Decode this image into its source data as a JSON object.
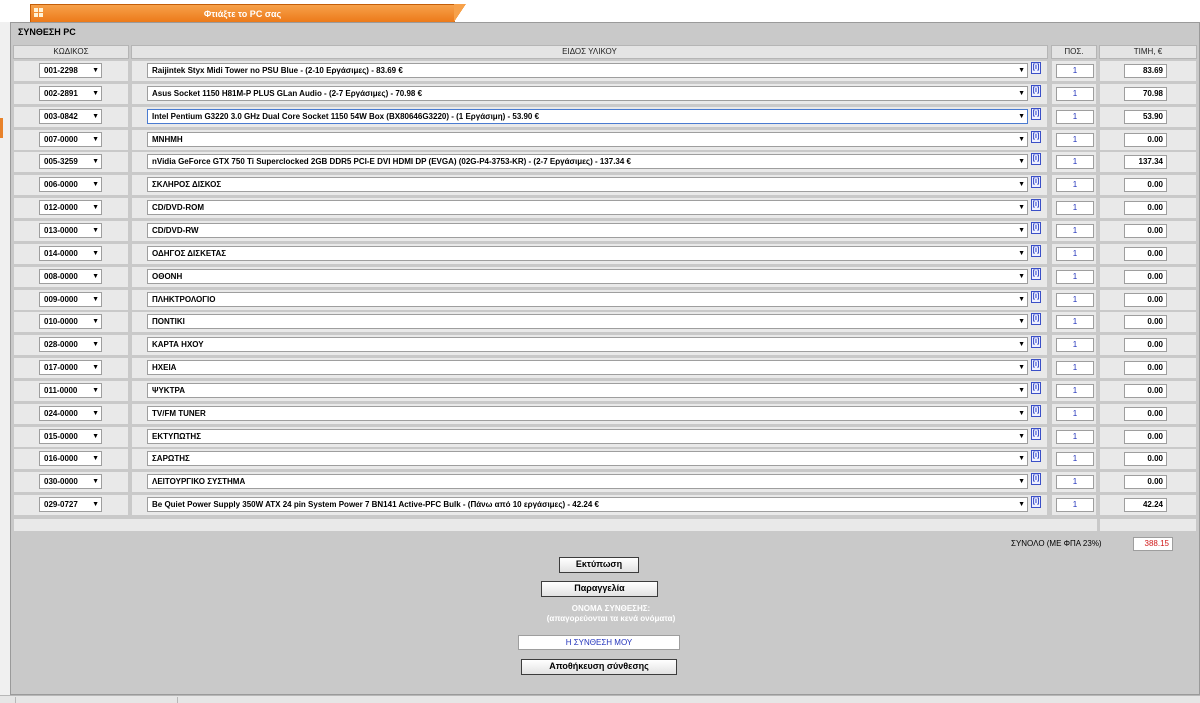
{
  "tab": {
    "label": "Φτιάξτε το PC σας"
  },
  "section": {
    "title": "ΣΥΝΘΕΣΗ PC"
  },
  "columns": {
    "code": "ΚΩΔΙΚΟΣ",
    "item": "ΕΙΔΟΣ ΥΛΙΚΟΥ",
    "qty": "ΠΟΣ.",
    "price": "ΤΙΜΗ, €"
  },
  "info_label": "[i]",
  "rows": [
    {
      "code": "001-2298",
      "item": "Raijintek Styx Midi Tower no PSU Blue - (2-10 Εργάσιμες) - 83.69 €",
      "qty": "1",
      "price": "83.69"
    },
    {
      "code": "002-2891",
      "item": "Asus Socket 1150 H81M-P PLUS GLan Audio - (2-7 Εργάσιμες) - 70.98 €",
      "qty": "1",
      "price": "70.98"
    },
    {
      "code": "003-0842",
      "item": "Intel Pentium G3220 3.0 GHz Dual Core Socket 1150 54W Box (BX80646G3220) - (1 Εργάσιμη) - 53.90 €",
      "qty": "1",
      "price": "53.90"
    },
    {
      "code": "007-0000",
      "item": "ΜΝΗΜΗ",
      "qty": "1",
      "price": "0.00"
    },
    {
      "code": "005-3259",
      "item": "nVidia GeForce GTX 750 Ti Superclocked 2GB DDR5 PCI-E DVI HDMI DP (EVGA) (02G-P4-3753-KR) - (2-7 Εργάσιμες) - 137.34 €",
      "qty": "1",
      "price": "137.34"
    },
    {
      "code": "006-0000",
      "item": "ΣΚΛΗΡΟΣ ΔΙΣΚΟΣ",
      "qty": "1",
      "price": "0.00"
    },
    {
      "code": "012-0000",
      "item": "CD/DVD-ROM",
      "qty": "1",
      "price": "0.00"
    },
    {
      "code": "013-0000",
      "item": "CD/DVD-RW",
      "qty": "1",
      "price": "0.00"
    },
    {
      "code": "014-0000",
      "item": "ΟΔΗΓΟΣ ΔΙΣΚΕΤΑΣ",
      "qty": "1",
      "price": "0.00"
    },
    {
      "code": "008-0000",
      "item": "ΟΘΟΝΗ",
      "qty": "1",
      "price": "0.00"
    },
    {
      "code": "009-0000",
      "item": "ΠΛΗΚΤΡΟΛΟΓΙΟ",
      "qty": "1",
      "price": "0.00"
    },
    {
      "code": "010-0000",
      "item": "ΠΟΝΤΙΚΙ",
      "qty": "1",
      "price": "0.00"
    },
    {
      "code": "028-0000",
      "item": "ΚΑΡΤΑ ΗΧΟΥ",
      "qty": "1",
      "price": "0.00"
    },
    {
      "code": "017-0000",
      "item": "ΗΧΕΙΑ",
      "qty": "1",
      "price": "0.00"
    },
    {
      "code": "011-0000",
      "item": "ΨΥΚΤΡΑ",
      "qty": "1",
      "price": "0.00"
    },
    {
      "code": "024-0000",
      "item": "TV/FM TUNER",
      "qty": "1",
      "price": "0.00"
    },
    {
      "code": "015-0000",
      "item": "ΕΚΤΥΠΩΤΗΣ",
      "qty": "1",
      "price": "0.00"
    },
    {
      "code": "016-0000",
      "item": "ΣΑΡΩΤΗΣ",
      "qty": "1",
      "price": "0.00"
    },
    {
      "code": "030-0000",
      "item": "ΛΕΙΤΟΥΡΓΙΚΟ ΣΥΣΤΗΜΑ",
      "qty": "1",
      "price": "0.00"
    },
    {
      "code": "029-0727",
      "item": "Be Quiet Power Supply 350W ATX 24 pin System Power 7 BN141 Active-PFC Bulk - (Πάνω από 10 εργάσιμες) - 42.24 €",
      "qty": "1",
      "price": "42.24"
    }
  ],
  "total": {
    "label": "ΣΥΝΟΛΟ (ΜΕ ΦΠΑ 23%)",
    "value": "388.15"
  },
  "buttons": {
    "print": "Εκτύπωση",
    "order": "Παραγγελία",
    "save": "Αποθήκευση σύνθεσης"
  },
  "save_name": {
    "label_line1": "ΟΝΟΜΑ ΣΥΝΘΕΣΗΣ:",
    "label_line2": "(απαγορεύονται τα κενά ονόματα)",
    "value": "Η ΣΥΝΘΕΣΗ ΜΟΥ"
  },
  "colors": {
    "tab": "#ec7a1a",
    "total_value": "#d01818",
    "qty_text": "#2233bb"
  }
}
